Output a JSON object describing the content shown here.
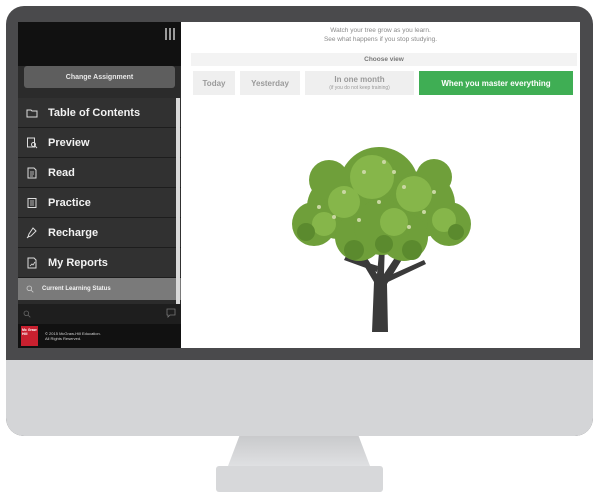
{
  "sidebar": {
    "change_assignment_label": "Change Assignment",
    "items": [
      {
        "label": "Table of Contents",
        "icon": "folder-icon"
      },
      {
        "label": "Preview",
        "icon": "preview-icon"
      },
      {
        "label": "Read",
        "icon": "document-icon"
      },
      {
        "label": "Practice",
        "icon": "practice-icon"
      },
      {
        "label": "Recharge",
        "icon": "recharge-icon"
      },
      {
        "label": "My Reports",
        "icon": "reports-icon"
      }
    ],
    "status_item": {
      "label": "Current Learning Status",
      "icon": "search-icon"
    },
    "logo": "Mc Graw Hill",
    "copyright_line1": "© 2015 McGraw-Hill Education.",
    "copyright_line2": "All Rights Reserved."
  },
  "main": {
    "hint_line1": "Watch your tree grow as you learn.",
    "hint_line2": "See what happens if you stop studying.",
    "choose_view_label": "Choose view",
    "views": [
      {
        "label": "Today",
        "sub": ""
      },
      {
        "label": "Yesterday",
        "sub": ""
      },
      {
        "label": "In one month",
        "sub": "(if you do not keep training)"
      },
      {
        "label": "When you master everything",
        "sub": ""
      }
    ],
    "active_view_index": 3
  },
  "colors": {
    "active_green": "#3fae54",
    "brand_red": "#c8202f",
    "sidebar_bg": "#313131"
  }
}
